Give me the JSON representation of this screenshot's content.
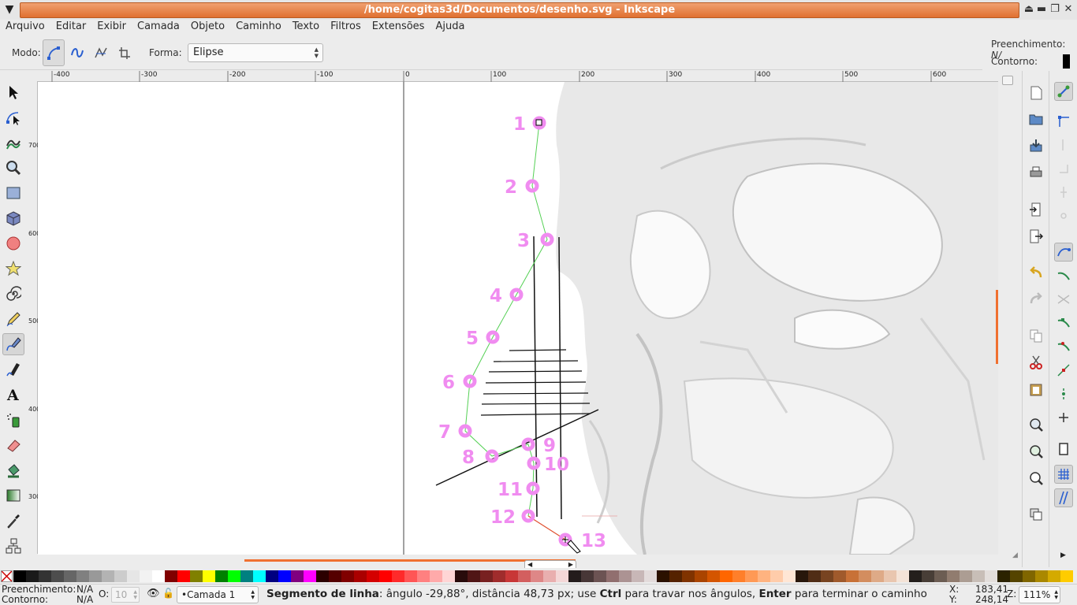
{
  "window": {
    "title": "/home/cogitas3d/Documentos/desenho.svg - Inkscape"
  },
  "menu": [
    "Arquivo",
    "Editar",
    "Exibir",
    "Camada",
    "Objeto",
    "Caminho",
    "Texto",
    "Filtros",
    "Extensões",
    "Ajuda"
  ],
  "toolbar": {
    "mode_label": "Modo:",
    "shape_label": "Forma:",
    "shape_value": "Elipse"
  },
  "style_indicator": {
    "fill_label": "Preenchimento:",
    "fill_value": "N/",
    "stroke_label": "Contorno:"
  },
  "ruler": {
    "h_ticks": [
      "-400",
      "-300",
      "-200",
      "-100",
      "0",
      "100",
      "200",
      "300",
      "400",
      "500",
      "600"
    ],
    "v_ticks": [
      "700",
      "600",
      "500",
      "400",
      "300"
    ]
  },
  "canvas": {
    "point_labels": [
      "1",
      "2",
      "3",
      "4",
      "5",
      "6",
      "7",
      "8",
      "9",
      "10",
      "11",
      "12",
      "13"
    ]
  },
  "palette": {
    "colors": [
      "#000000",
      "#1a1a1a",
      "#333333",
      "#4d4d4d",
      "#666666",
      "#808080",
      "#999999",
      "#b3b3b3",
      "#cccccc",
      "#e6e6e6",
      "#f2f2f2",
      "#ffffff",
      "#800000",
      "#ff0000",
      "#808000",
      "#ffff00",
      "#008000",
      "#00ff00",
      "#008080",
      "#00ffff",
      "#000080",
      "#0000ff",
      "#800080",
      "#ff00ff",
      "#2b0000",
      "#550000",
      "#800000",
      "#aa0000",
      "#d40000",
      "#ff0000",
      "#ff2a2a",
      "#ff5555",
      "#ff8080",
      "#ffaaaa",
      "#ffd5d5",
      "#280b0b",
      "#501616",
      "#782121",
      "#a02c2c",
      "#c83737",
      "#d35f5f",
      "#de8787",
      "#e9afaf",
      "#f4d7d7",
      "#241c1c",
      "#483737",
      "#6c5353",
      "#916f6f",
      "#ac9393",
      "#c8b7b7",
      "#e3dbdb",
      "#2b1100",
      "#552200",
      "#803300",
      "#aa4400",
      "#d45500",
      "#ff6600",
      "#ff7f2a",
      "#ff9955",
      "#ffb380",
      "#ffccaa",
      "#ffe6d5",
      "#28170b",
      "#502d16",
      "#784421",
      "#a05a2c",
      "#c87137",
      "#d38d5f",
      "#deaa87",
      "#e9c6af",
      "#f4e3d7",
      "#241f1c",
      "#483e37",
      "#6c5d53",
      "#917c6f",
      "#ac9d93",
      "#c8beb7",
      "#e3dedb",
      "#2b2200",
      "#554400",
      "#806600",
      "#aa8800",
      "#d4aa00",
      "#ffcc00"
    ]
  },
  "status": {
    "fill_label": "Preenchimento:",
    "fill_value": "N/A",
    "stroke_label": "Contorno:",
    "stroke_value": "N/A",
    "opacity_label": "O:",
    "opacity_value": "10",
    "layer": "•Camada 1",
    "message_bold": "Segmento de linha",
    "message_1": ": ângulo -29,88°, distância 48,73 px; use ",
    "key_ctrl": "Ctrl",
    "message_2": " para travar nos ângulos, ",
    "key_enter": "Enter",
    "message_3": " para terminar o caminho",
    "x_label": "X:",
    "x_value": "183,41",
    "y_label": "Y:",
    "y_value": "248,14",
    "zoom_label": "Z:",
    "zoom_value": "111%"
  }
}
